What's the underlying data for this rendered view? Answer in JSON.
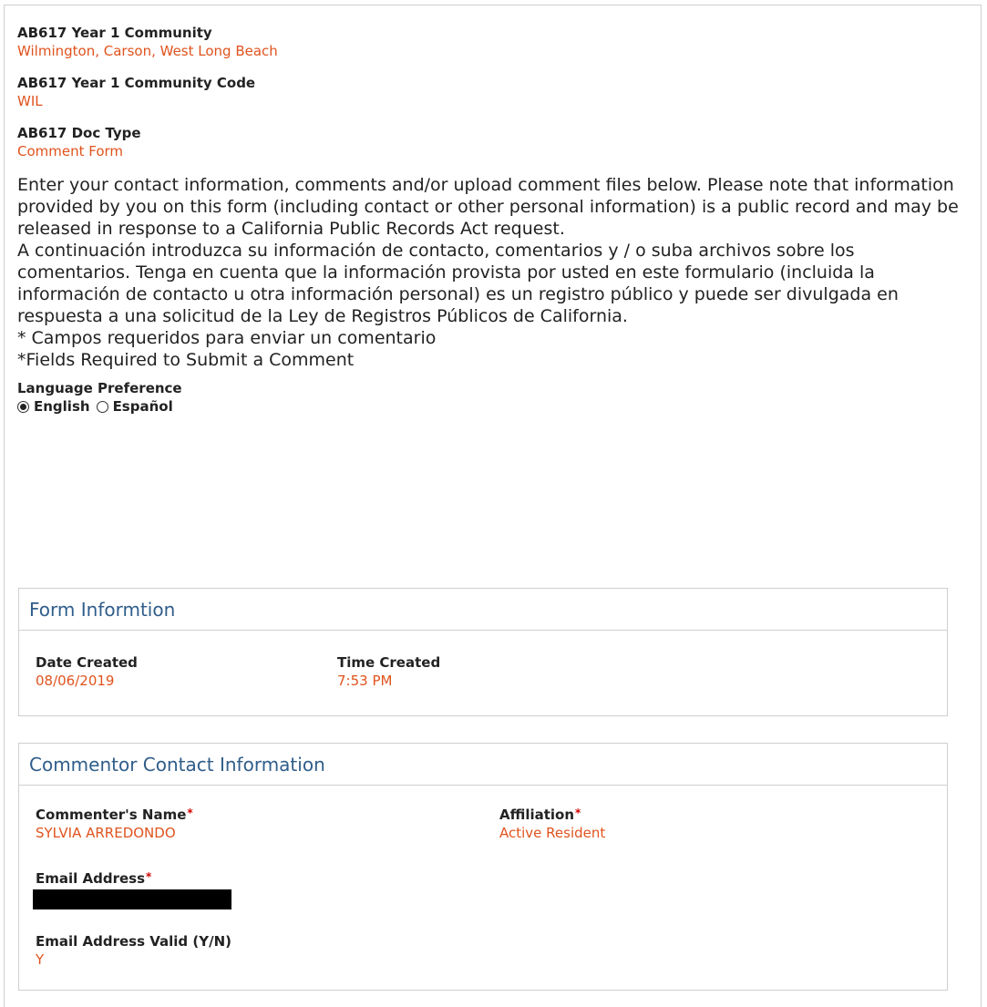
{
  "community": {
    "label": "AB617 Year 1 Community",
    "value": "Wilmington, Carson, West Long Beach"
  },
  "community_code": {
    "label": "AB617 Year 1 Community Code",
    "value": "WIL"
  },
  "doc_type": {
    "label": "AB617 Doc Type",
    "value": "Comment Form"
  },
  "intro": {
    "english": "Enter your contact information, comments and/or upload comment files below. Please note that information provided by you on this form (including contact or other personal information) is a public record and may be released in response to a California Public Records Act request.",
    "spanish": "A continuación introduzca su información de contacto, comentarios y / o suba archivos sobre los comentarios. Tenga en cuenta que la información provista por usted en este formulario (incluida la información de contacto u otra información personal) es un registro público y puede ser divulgada en respuesta a una solicitud de la Ley de Registros Públicos de California.",
    "required_es": "* Campos requeridos para enviar un comentario",
    "required_en": "*Fields Required to Submit a Comment"
  },
  "language": {
    "label": "Language Preference",
    "options": [
      {
        "label": "English",
        "selected": true
      },
      {
        "label": "Español",
        "selected": false
      }
    ]
  },
  "form_info": {
    "title": "Form Informtion",
    "date_label": "Date Created",
    "date_value": "08/06/2019",
    "time_label": "Time Created",
    "time_value": "7:53 PM"
  },
  "contact": {
    "title": "Commentor Contact Information",
    "name_label": "Commenter's Name",
    "name_value": "SYLVIA ARREDONDO",
    "affiliation_label": "Affiliation",
    "affiliation_value": "Active Resident",
    "email_label": "Email Address",
    "email_valid_label": "Email Address Valid (Y/N)",
    "email_valid_value": "Y",
    "required_mark": "*"
  },
  "colors": {
    "value_text": "#e0531e",
    "panel_title": "#2f5d8a",
    "required_mark": "#d40000",
    "border": "#cfcfcf"
  }
}
